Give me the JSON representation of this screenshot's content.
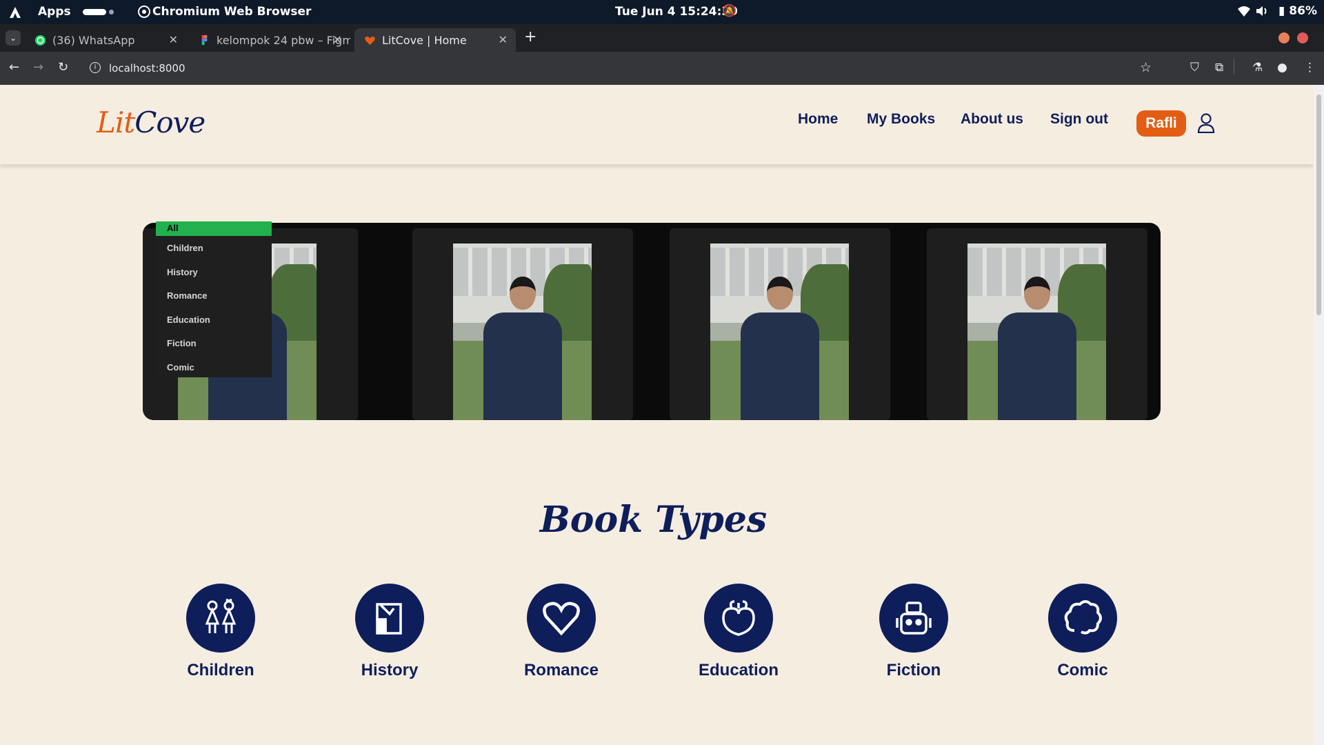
{
  "os": {
    "apps_label": "Apps",
    "app_name": "Chromium Web Browser",
    "clock": "Tue Jun 4  15:24:39",
    "battery": "86%"
  },
  "browser": {
    "tabs": [
      {
        "title": "(36) WhatsApp",
        "icon": "whatsapp-icon",
        "color": "#25d366"
      },
      {
        "title": "kelompok 24 pbw – Figma",
        "icon": "figma-icon",
        "color": "#f24e1e"
      },
      {
        "title": "LitCove | Home",
        "icon": "heart-icon",
        "color": "#e35d14"
      }
    ],
    "new_tab": "+",
    "url": "localhost:8000"
  },
  "site": {
    "brand_lit": "Lit",
    "brand_cove": "Cove",
    "nav": [
      "Home",
      "My Books",
      "About us",
      "Sign out"
    ],
    "user_name": "Rafli",
    "categories": [
      "All",
      "Children",
      "History",
      "Romance",
      "Education",
      "Fiction",
      "Comic"
    ],
    "active_category": "All",
    "section_title": "Book Types",
    "book_types": [
      {
        "label": "Children",
        "icon": "children-icon"
      },
      {
        "label": "History",
        "icon": "history-icon"
      },
      {
        "label": "Romance",
        "icon": "heart-icon"
      },
      {
        "label": "Education",
        "icon": "brain-icon"
      },
      {
        "label": "Fiction",
        "icon": "robot-icon"
      },
      {
        "label": "Comic",
        "icon": "cloud-icon"
      }
    ]
  },
  "colors": {
    "accent": "#e35d14",
    "navy": "#0e1e5b",
    "active_green": "#22b14c",
    "page_bg": "#f6ede1"
  }
}
